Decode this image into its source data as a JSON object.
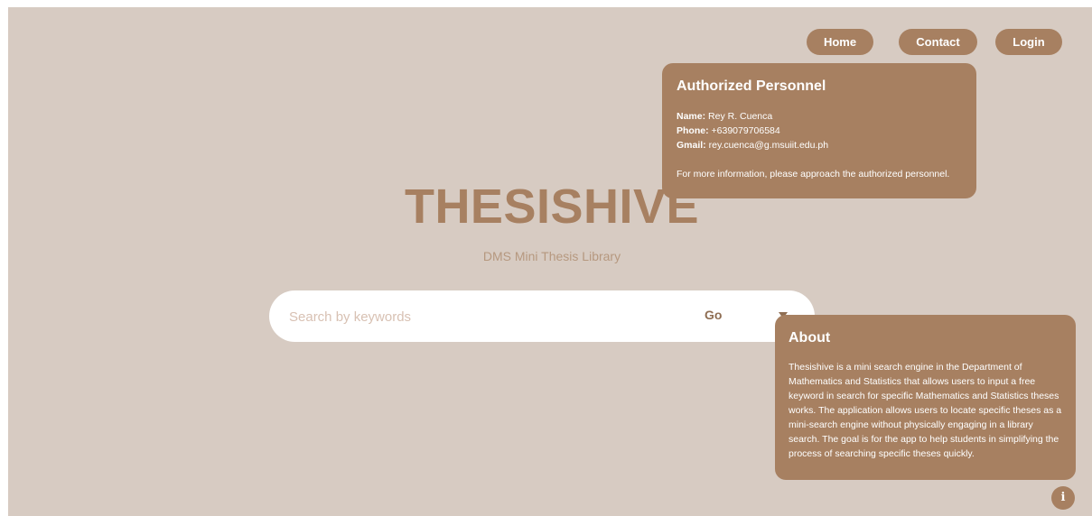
{
  "nav": {
    "home_label": "Home",
    "contact_label": "Contact",
    "login_label": "Login"
  },
  "hero": {
    "title": "THESISHIVE",
    "subtitle": "DMS Mini Thesis Library"
  },
  "search": {
    "placeholder": "Search by keywords",
    "value": "",
    "go_label": "Go",
    "dropdown_icon": "caret-down-icon"
  },
  "contact_popup": {
    "title": "Authorized Personnel",
    "name_label": "Name:",
    "name_value": "Rey R. Cuenca",
    "phone_label": "Phone:",
    "phone_value": "+639079706584",
    "gmail_label": "Gmail:",
    "gmail_value": "rey.cuenca@g.msuiit.edu.ph",
    "note": "For more information, please approach the authorized personnel."
  },
  "about_popup": {
    "title": "About",
    "text": "Thesishive is a mini search engine in the Department of Mathematics and Statistics that allows users to input a free keyword in search for specific Mathematics and Statistics theses works. The application allows users to locate specific theses as a mini-search engine without physically engaging in a library search. The goal is for the app to help students in simplifying the process of searching specific theses quickly."
  },
  "info_button": {
    "glyph": "i",
    "icon": "info-icon"
  },
  "colors": {
    "background": "#d7cbc2",
    "accent": "#a78061",
    "subtitle": "#b6987f",
    "search_bg": "#ffffff"
  }
}
